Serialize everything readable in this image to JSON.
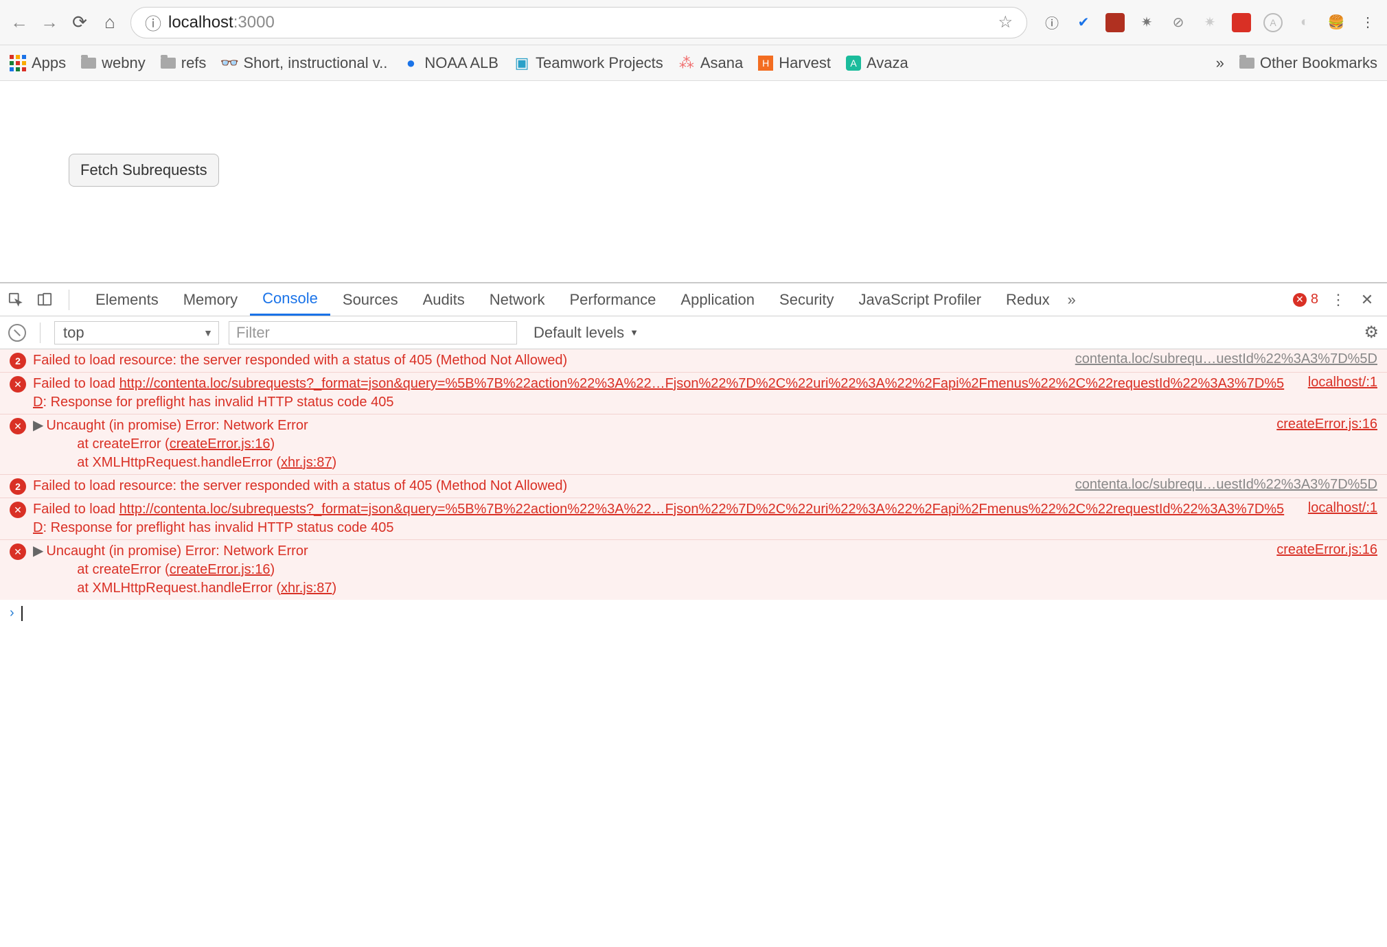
{
  "chrome": {
    "url_host": "localhost",
    "url_port": ":3000"
  },
  "bookmarks": {
    "apps": "Apps",
    "items": [
      "webny",
      "refs",
      "Short, instructional v..",
      "NOAA ALB",
      "Teamwork Projects",
      "Asana",
      "Harvest",
      "Avaza"
    ],
    "overflow": "»",
    "other": "Other Bookmarks"
  },
  "page": {
    "button": "Fetch Subrequests"
  },
  "devtools": {
    "tabs": [
      "Elements",
      "Memory",
      "Console",
      "Sources",
      "Audits",
      "Network",
      "Performance",
      "Application",
      "Security",
      "JavaScript Profiler",
      "Redux"
    ],
    "active_tab": "Console",
    "overflow": "»",
    "error_count": "8",
    "toolbar": {
      "context": "top",
      "filter_placeholder": "Filter",
      "levels": "Default levels"
    }
  },
  "console": {
    "messages": [
      {
        "type": "count-error",
        "count": "2",
        "text": "Failed to load resource: the server responded with a status of 405 (Method Not Allowed)",
        "source": "contenta.loc/subrequ…uestId%22%3A3%7D%5D"
      },
      {
        "type": "error",
        "prefix": "Failed to load ",
        "link": "http://contenta.loc/subrequests?_format=json&query=%5B%7B%22action%22%3A%22…Fjson%22%7D%2C%22uri%22%3A%22%2Fapi%2Fmenus%22%2C%22requestId%22%3A3%7D%5D",
        "suffix": ": Response for preflight has invalid HTTP status code 405",
        "source": "localhost/:1"
      },
      {
        "type": "expand-error",
        "text": "Uncaught (in promise) Error: Network Error",
        "stack": [
          {
            "pre": "    at createError (",
            "link": "createError.js:16",
            "post": ")"
          },
          {
            "pre": "    at XMLHttpRequest.handleError (",
            "link": "xhr.js:87",
            "post": ")"
          }
        ],
        "source": "createError.js:16"
      },
      {
        "type": "count-error",
        "count": "2",
        "text": "Failed to load resource: the server responded with a status of 405 (Method Not Allowed)",
        "source": "contenta.loc/subrequ…uestId%22%3A3%7D%5D"
      },
      {
        "type": "error",
        "prefix": "Failed to load ",
        "link": "http://contenta.loc/subrequests?_format=json&query=%5B%7B%22action%22%3A%22…Fjson%22%7D%2C%22uri%22%3A%22%2Fapi%2Fmenus%22%2C%22requestId%22%3A3%7D%5D",
        "suffix": ": Response for preflight has invalid HTTP status code 405",
        "source": "localhost/:1"
      },
      {
        "type": "expand-error",
        "text": "Uncaught (in promise) Error: Network Error",
        "stack": [
          {
            "pre": "    at createError (",
            "link": "createError.js:16",
            "post": ")"
          },
          {
            "pre": "    at XMLHttpRequest.handleError (",
            "link": "xhr.js:87",
            "post": ")"
          }
        ],
        "source": "createError.js:16"
      }
    ]
  }
}
